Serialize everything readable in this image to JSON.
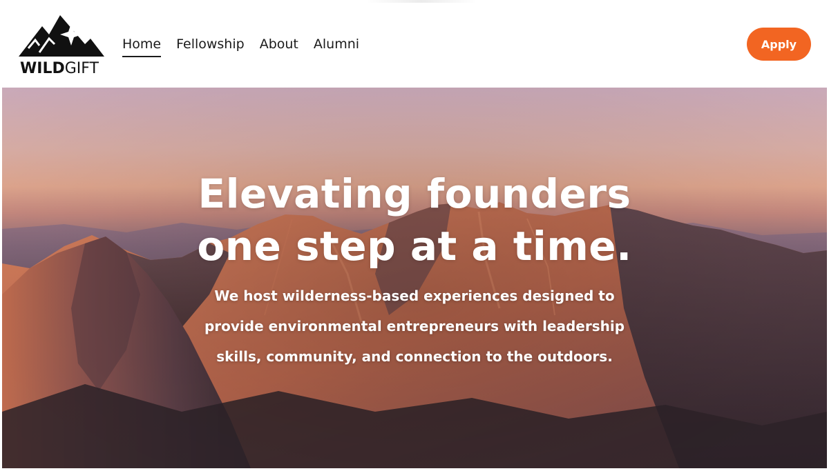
{
  "brand": {
    "wordmark_bold": "WILD",
    "wordmark_light": "GIFT",
    "logo_icon": "mountain-star-icon"
  },
  "nav": {
    "items": [
      {
        "label": "Home",
        "active": true
      },
      {
        "label": "Fellowship",
        "active": false
      },
      {
        "label": "About",
        "active": false
      },
      {
        "label": "Alumni",
        "active": false
      }
    ]
  },
  "header": {
    "cta_label": "Apply",
    "cta_color": "#f26522"
  },
  "hero": {
    "title_line1": "Elevating founders",
    "title_line2": "one step at a time.",
    "subtitle_line1": "We host wilderness-based experiences designed to",
    "subtitle_line2": "provide environmental entrepreneurs with leadership",
    "subtitle_line3": "skills, community, and connection to the outdoors.",
    "background": "alpenglow-mountain-range-photo"
  }
}
